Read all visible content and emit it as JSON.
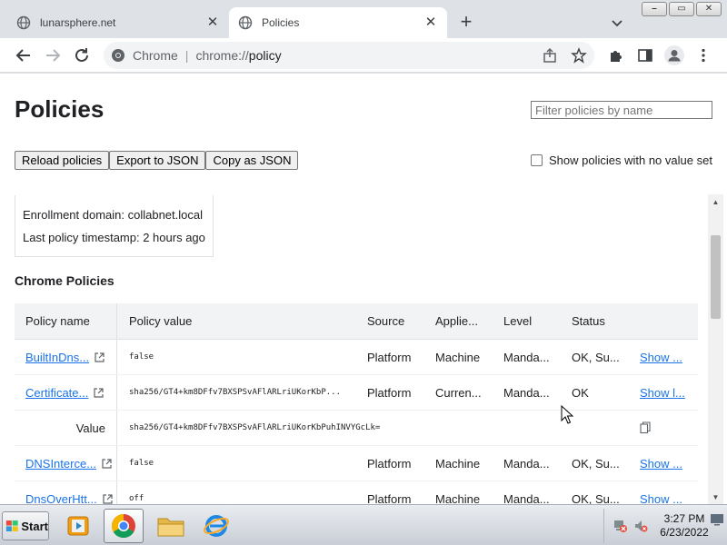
{
  "tabs": [
    {
      "title": "lunarsphere.net",
      "active": false
    },
    {
      "title": "Policies",
      "active": true
    }
  ],
  "window": {
    "minimize": "⎯",
    "maximize": "▭",
    "close": "✕"
  },
  "omnibox": {
    "scheme": "Chrome",
    "host": "chrome://",
    "path": "policy"
  },
  "page": {
    "title": "Policies",
    "filter_placeholder": "Filter policies by name",
    "buttons": {
      "reload": "Reload policies",
      "export": "Export to JSON",
      "copy": "Copy as JSON"
    },
    "show_unset_label": "Show policies with no value set",
    "status": {
      "enrollment": "Enrollment domain: collabnet.local",
      "timestamp": "Last policy timestamp: 2 hours ago"
    },
    "section_title": "Chrome Policies"
  },
  "table": {
    "headers": {
      "name": "Policy name",
      "value": "Policy value",
      "source": "Source",
      "applies": "Applie...",
      "level": "Level",
      "status": "Status"
    },
    "rows": [
      {
        "name": "BuiltInDns...",
        "value": "false",
        "source": "Platform",
        "applies": "Machine",
        "level": "Manda...",
        "status": "OK, Su...",
        "show": "Show ..."
      },
      {
        "name": "Certificate...",
        "value": "sha256/GT4+km8DFfv7BXSPSvAFlARLriUKorKbP...",
        "source": "Platform",
        "applies": "Curren...",
        "level": "Manda...",
        "status": "OK",
        "show": "Show l..."
      },
      {
        "name": "DNSInterce...",
        "value": "false",
        "source": "Platform",
        "applies": "Machine",
        "level": "Manda...",
        "status": "OK, Su...",
        "show": "Show ..."
      },
      {
        "name": "DnsOverHtt...",
        "value": "off",
        "source": "Platform",
        "applies": "Machine",
        "level": "Manda...",
        "status": "OK, Su...",
        "show": "Show ..."
      }
    ],
    "value_row": {
      "label": "Value",
      "value": "sha256/GT4+km8DFfv7BXSPSvAFlARLriUKorKbPuhINVYGcLk="
    }
  },
  "taskbar": {
    "start": "Start",
    "time": "3:27 PM",
    "date": "6/23/2022"
  },
  "colors": {
    "link": "#1a73e8",
    "chrome_frame": "#dee1e6",
    "header_bg": "#f1f3f4"
  }
}
